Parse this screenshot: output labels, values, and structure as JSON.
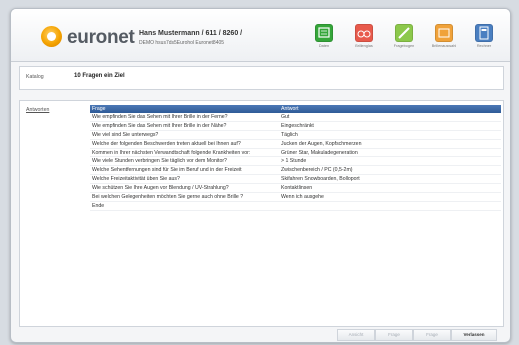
{
  "header": {
    "brand": "euronet",
    "user_line": "Hans Mustermann / 611 / 8260 /",
    "user_sub": "DEMO hsus7ds5Eurohol Euronet8405",
    "tools": [
      {
        "label": "Daten",
        "icon": "data-icon",
        "color": "#35a63a"
      },
      {
        "label": "Brillenglas",
        "icon": "lens-icon",
        "color": "#e85a4c"
      },
      {
        "label": "Fragebogen",
        "icon": "pencil-icon",
        "color": "#8cc84b"
      },
      {
        "label": "Brillenauswahl",
        "icon": "glasses-icon",
        "color": "#f0a23a"
      },
      {
        "label": "Rechner",
        "icon": "calculator-icon",
        "color": "#4a7fc1"
      }
    ]
  },
  "catalog": {
    "label": "Katalog",
    "value": "10 Fragen ein Ziel"
  },
  "answers": {
    "label": "Antworten",
    "columns": [
      "Frage",
      "Antwort"
    ],
    "rows": [
      [
        "Wie empfinden Sie das Sehen mit Ihrer Brille in der Ferne?",
        "Gut"
      ],
      [
        "Wie empfinden Sie das Sehen mit Ihrer Brille in der Nähe?",
        "Eingeschränkt"
      ],
      [
        "Wie viel sind Sie unterwegs?",
        "Täglich"
      ],
      [
        "Welche der folgenden Beschwerden treten aktuell bei Ihnen auf?",
        "Jucken der Augen, Kopfschmerzen"
      ],
      [
        "Kommen in Ihrer nächsten Verwandtschaft folgende Krankheiten vor:",
        "Grüner Star, Makuladegeneration"
      ],
      [
        "Wie viele Stunden verbringen Sie täglich vor dem Monitor?",
        "> 1 Stunde"
      ],
      [
        "Welche Sehentfernungen sind für Sie im Beruf und in der Freizeit",
        "Zwischenbereich / PC (0,5-2m)"
      ],
      [
        "Welche Freizeitaktivität üben Sie aus?",
        "Skifahren Snowboarden, Bolloport"
      ],
      [
        "Wie schützen Sie Ihre Augen vor Blendung / UV-Strahlung?",
        "Kontaktlinsen"
      ],
      [
        "Bei welchen Gelegenheiten möchten Sie gerne auch ohne Brille ?",
        "Wenn ich ausgehe"
      ],
      [
        "Ende",
        ""
      ]
    ]
  },
  "footer": {
    "buttons": [
      "Ansicht",
      "Frage",
      "Frage",
      "Verlassen"
    ]
  }
}
